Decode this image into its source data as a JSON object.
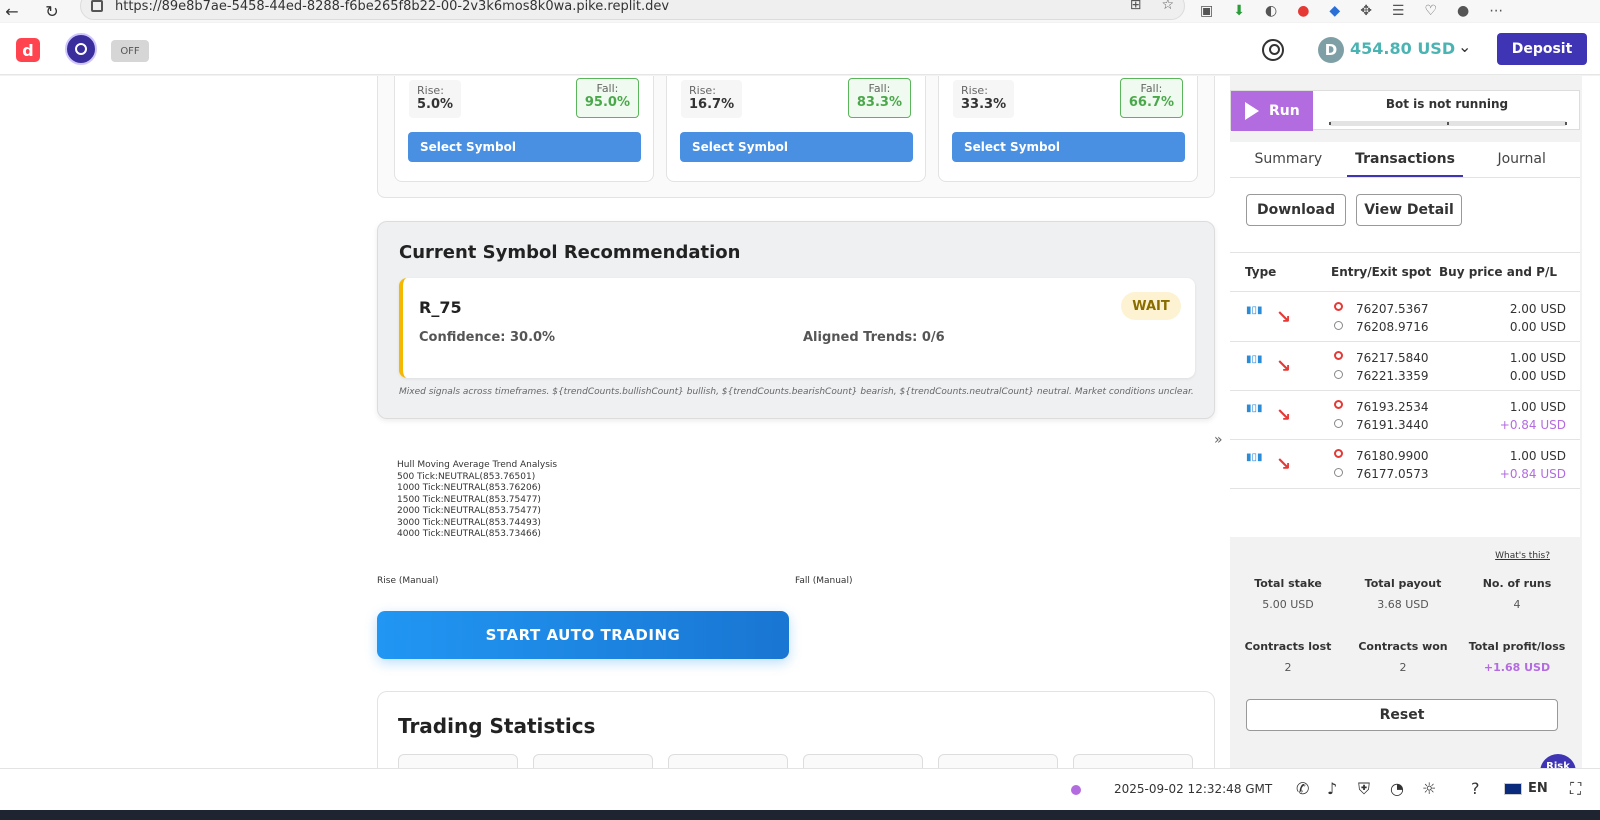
{
  "browser": {
    "url": "https://89e8b7ae-5458-44ed-8288-f6be265f8b22-00-2v3k6mos8k0wa.pike.replit.dev"
  },
  "header": {
    "off_label": "OFF",
    "balance": "454.80 USD",
    "deposit_label": "Deposit",
    "currency_symbol": "D"
  },
  "symbols": {
    "cards": [
      {
        "rise_label": "Rise:",
        "rise": "5.0%",
        "fall_label": "Fall:",
        "fall": "95.0%",
        "button": "Select Symbol"
      },
      {
        "rise_label": "Rise:",
        "rise": "16.7%",
        "fall_label": "Fall:",
        "fall": "83.3%",
        "button": "Select Symbol"
      },
      {
        "rise_label": "Rise:",
        "rise": "33.3%",
        "fall_label": "Fall:",
        "fall": "66.7%",
        "button": "Select Symbol"
      }
    ]
  },
  "recommendation": {
    "title": "Current Symbol Recommendation",
    "symbol": "R_75",
    "badge": "WAIT",
    "confidence": "Confidence: 30.0%",
    "aligned": "Aligned Trends: 0/6",
    "note": "Mixed signals across timeframes. ${trendCounts.bullishCount} bullish, ${trendCounts.bearishCount} bearish, ${trendCounts.neutralCount} neutral. Market conditions unclear."
  },
  "hull": {
    "title": "Hull Moving Average Trend Analysis",
    "lines": [
      "500 Tick:NEUTRAL(853.76501)",
      "1000 Tick:NEUTRAL(853.76206)",
      "1500 Tick:NEUTRAL(853.75477)",
      "2000 Tick:NEUTRAL(853.75477)",
      "3000 Tick:NEUTRAL(853.74493)",
      "4000 Tick:NEUTRAL(853.73466)"
    ]
  },
  "manual": {
    "rise": "Rise (Manual)",
    "fall": "Fall (Manual)"
  },
  "auto_trading_label": "START AUTO TRADING",
  "stats_title": "Trading Statistics",
  "run_panel": {
    "run_label": "Run",
    "status": "Bot is not running"
  },
  "tabs": [
    "Summary",
    "Transactions",
    "Journal"
  ],
  "tx_actions": {
    "download": "Download",
    "view_detail": "View Detail"
  },
  "tx_headers": {
    "type": "Type",
    "spot": "Entry/Exit spot",
    "price": "Buy price and P/L"
  },
  "transactions": [
    {
      "entry": "76207.5367",
      "exit": "76208.9716",
      "buy": "2.00 USD",
      "pl": "0.00 USD",
      "profit": false
    },
    {
      "entry": "76217.5840",
      "exit": "76221.3359",
      "buy": "1.00 USD",
      "pl": "0.00 USD",
      "profit": false
    },
    {
      "entry": "76193.2534",
      "exit": "76191.3440",
      "buy": "1.00 USD",
      "pl": "+0.84 USD",
      "profit": true
    },
    {
      "entry": "76180.9900",
      "exit": "76177.0573",
      "buy": "1.00 USD",
      "pl": "+0.84 USD",
      "profit": true
    }
  ],
  "summary": {
    "whats_this": "What's this?",
    "total_stake_label": "Total stake",
    "total_stake": "5.00 USD",
    "total_payout_label": "Total payout",
    "total_payout": "3.68 USD",
    "runs_label": "No. of runs",
    "runs": "4",
    "lost_label": "Contracts lost",
    "lost": "2",
    "won_label": "Contracts won",
    "won": "2",
    "pl_label": "Total profit/loss",
    "pl": "+1.68 USD",
    "reset_label": "Reset"
  },
  "risk_chip": "Risk\nclaim",
  "footer": {
    "timestamp": "2025-09-02 12:32:48 GMT",
    "lang": "EN"
  },
  "colors": {
    "deposit": "#3f35b4",
    "run": "#b36ce0",
    "select": "#4a90e2",
    "fall_green": "#4aa84a",
    "profit": "#b36ce0",
    "balance": "#4bb4b3"
  }
}
